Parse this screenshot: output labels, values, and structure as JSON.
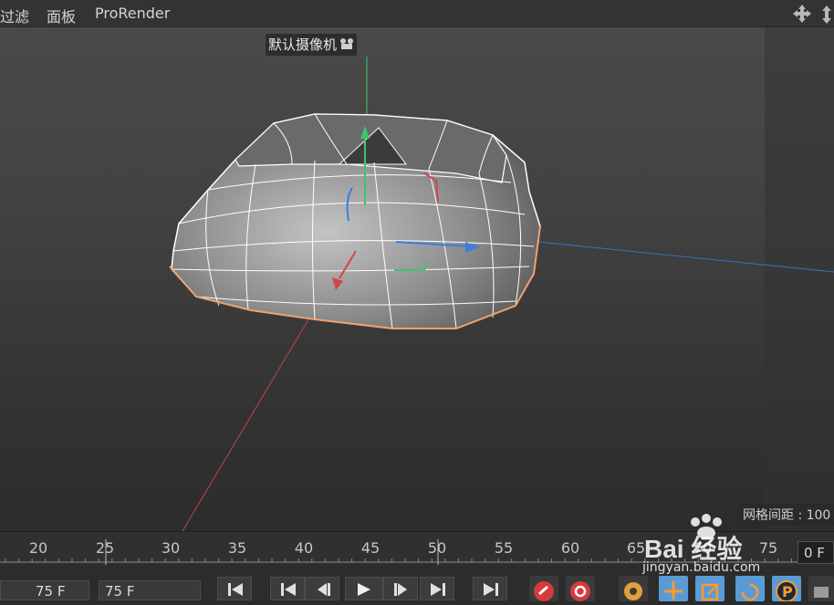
{
  "menubar": {
    "items": [
      "过滤",
      "面板",
      "ProRender"
    ]
  },
  "viewport": {
    "camera_label": "默认摄像机",
    "grid_spacing_label": "网格间距 : 100"
  },
  "timeline": {
    "ticks": [
      "20",
      "25",
      "30",
      "35",
      "40",
      "45",
      "50",
      "55",
      "60",
      "65",
      "70",
      "75"
    ]
  },
  "playback": {
    "field_a": "75 F",
    "field_b": "75 F",
    "current_frame": "0 F"
  },
  "watermark": {
    "logo": "Bai 经验",
    "url": "jingyan.baidu.com"
  },
  "colors": {
    "axis_x": "#d64545",
    "axis_y": "#3fc46a",
    "axis_z": "#3a7fd8",
    "selection_edge": "#f0a070",
    "wire": "#ffffff",
    "tool_active": "#5b9bd5"
  }
}
